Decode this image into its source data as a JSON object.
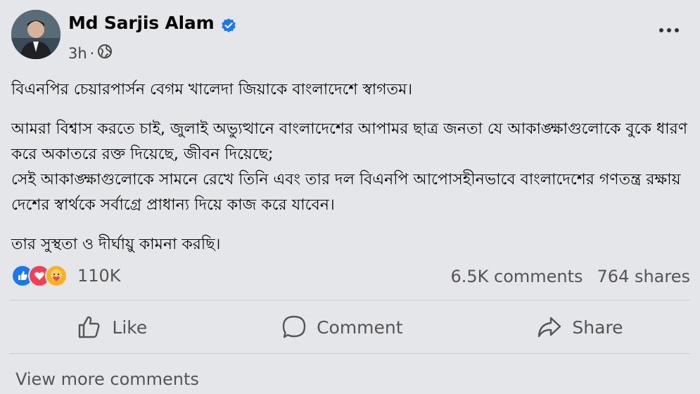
{
  "post": {
    "author": "Md Sarjis Alam",
    "time": "3h",
    "separator": "·",
    "paragraphs": [
      "বিএনপির চেয়ারপার্সন বেগম খালেদা জিয়াকে বাংলাদেশে স্বাগতম।",
      "আমরা বিশ্বাস করতে চাই, জুলাই অভ্যুত্থানে বাংলাদেশের আপামর ছাত্র জনতা যে আকাঙ্ক্ষাগুলোকে বুকে ধারণ করে অকাতরে রক্ত দিয়েছে, জীবন দিয়েছে;\nসেই আকাঙ্ক্ষাগুলোকে সামনে রেখে তিনি এবং তার দল বিএনপি আপোসহীনভাবে বাংলাদেশের গণতন্ত্র রক্ষায় দেশের স্বার্থকে সর্বাগ্রে প্রাধান্য দিয়ে কাজ করে যাবেন।",
      "তার সুস্থতা ও দীর্ঘায়ু কামনা করছি।"
    ],
    "reaction_count": "110K",
    "comments": "6.5K comments",
    "shares": "764 shares",
    "actions": {
      "like": "Like",
      "comment": "Comment",
      "share": "Share"
    },
    "view_more": "View more comments"
  },
  "icons": {
    "verified": "verified-badge-icon",
    "globe": "globe-icon",
    "more": "more-options-icon",
    "like": "thumbs-up-icon",
    "comment": "comment-bubble-icon",
    "share": "share-arrow-icon"
  },
  "colors": {
    "brand": "#1877f2",
    "love": "#f33e58",
    "care": "#f7b125",
    "background": "#e4e6e9"
  }
}
